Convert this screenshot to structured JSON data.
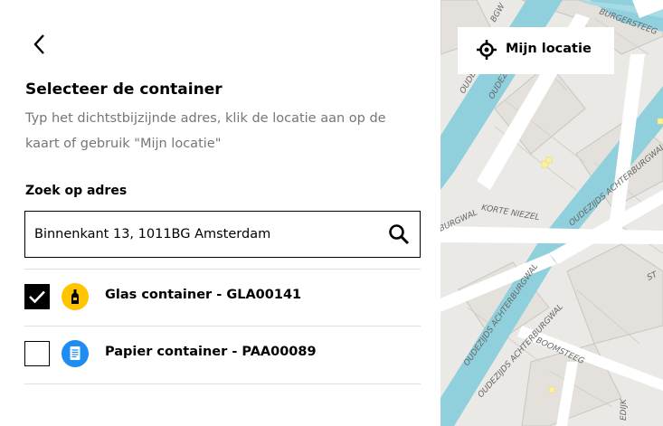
{
  "panel": {
    "back_icon": "chevron-left-icon",
    "title": "Selecteer de container",
    "description": "Typ het dichtstbijzijnde adres, klik de locatie aan op de kaart of gebruik \"Mijn locatie\"",
    "search_label": "Zoek op adres",
    "search_value": "Binnenkant 13, 1011BG Amsterdam",
    "search_icon": "search-icon",
    "containers": [
      {
        "label": "Glas container - GLA00141",
        "checked": true,
        "icon": "bottle-icon",
        "color": "#ffc400"
      },
      {
        "label": "Papier container - PAA00089",
        "checked": false,
        "icon": "paper-icon",
        "color": "#1e8cf0"
      }
    ]
  },
  "map": {
    "location_button_label": "Mijn locatie",
    "location_icon": "crosshair-icon",
    "water_color": "#8fd0dc",
    "street_labels": [
      "OUDEZIJDS VOORBURGWAL",
      "OUDEZIJDS VOORB",
      "OUDEZIJDS ACHTERBURGWAL",
      "KORTE NIEZEL",
      "BURGWAL",
      "OUDEZIJDS ACHTERBURGWAL",
      "BOOMSTEEG",
      "OUDEZIJDS ACHTERBURGWAL",
      "EDIJK",
      "BURGERSTEEG",
      "ST"
    ]
  }
}
